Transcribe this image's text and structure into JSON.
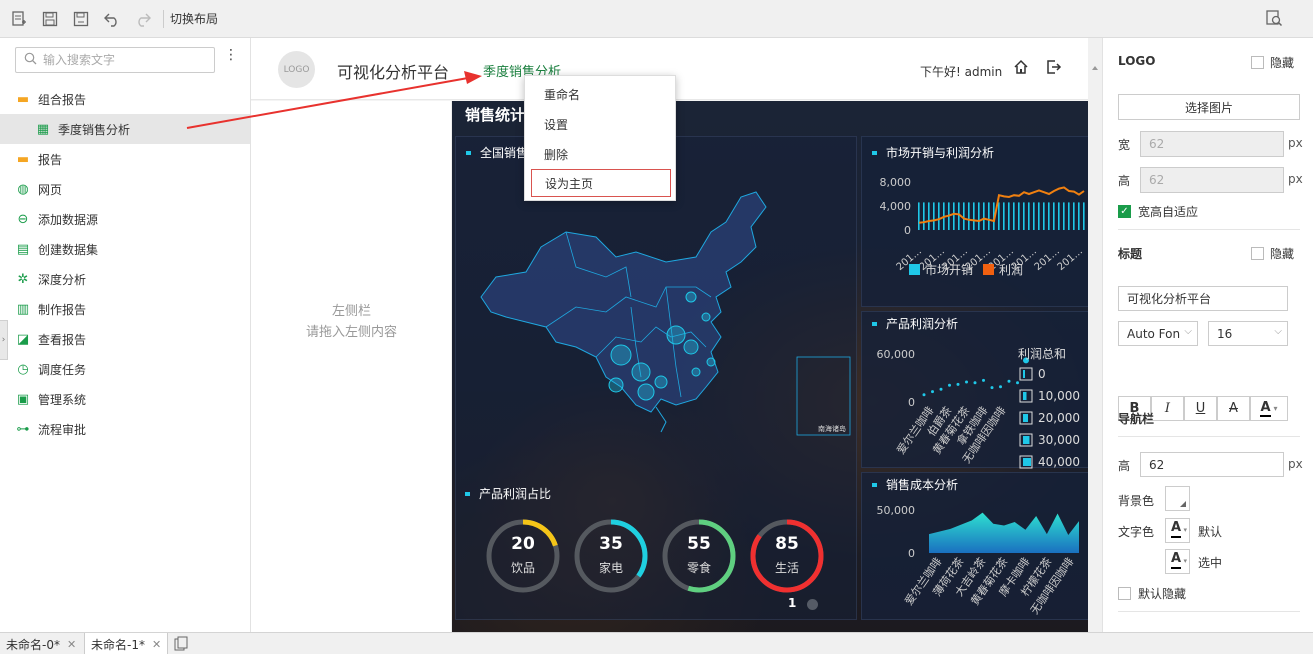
{
  "toolbar": {
    "icons": [
      "new-doc-icon",
      "save-icon",
      "save-as-icon",
      "undo-icon",
      "redo-icon"
    ],
    "switch_layout": "切换布局",
    "right_icon": "preview-icon"
  },
  "sidebar": {
    "search_placeholder": "输入搜索文字",
    "items": [
      {
        "label": "组合报告",
        "icon": "folder-icon",
        "color": "#f5a623"
      },
      {
        "label": "季度销售分析",
        "icon": "layout-icon",
        "color": "#1a9c4a",
        "child": true
      },
      {
        "label": "报告",
        "icon": "folder-icon",
        "color": "#f5a623"
      },
      {
        "label": "网页",
        "icon": "globe-icon",
        "color": "#1a9c4a"
      },
      {
        "label": "添加数据源",
        "icon": "link-icon",
        "color": "#1a9c4a"
      },
      {
        "label": "创建数据集",
        "icon": "dataset-icon",
        "color": "#1a9c4a"
      },
      {
        "label": "深度分析",
        "icon": "analysis-icon",
        "color": "#1a9c4a"
      },
      {
        "label": "制作报告",
        "icon": "chart-icon",
        "color": "#1a9c4a"
      },
      {
        "label": "查看报告",
        "icon": "view-report-icon",
        "color": "#1a9c4a"
      },
      {
        "label": "调度任务",
        "icon": "clock-icon",
        "color": "#1a9c4a"
      },
      {
        "label": "管理系统",
        "icon": "manage-icon",
        "color": "#1a9c4a"
      },
      {
        "label": "流程审批",
        "icon": "flow-icon",
        "color": "#1a9c4a"
      }
    ]
  },
  "header": {
    "logo": "LOGO",
    "title": "可视化分析平台",
    "nav_tab": "季度销售分析",
    "greeting": "下午好! admin"
  },
  "left_pane": {
    "line1": "左侧栏",
    "line2": "请拖入左侧内容"
  },
  "context_menu": {
    "items": [
      "重命名",
      "设置",
      "删除",
      "设为主页"
    ]
  },
  "dashboard": {
    "title": "销售统计",
    "panels": {
      "map": "全国销售",
      "market": "市场开销与利润分析",
      "profit": "产品利润分析",
      "share": "产品利润占比",
      "cost": "销售成本分析"
    },
    "south_sea_label": "南海诸岛",
    "pager": "1"
  },
  "chart_data": [
    {
      "type": "line",
      "title": "市场开销与利润分析",
      "y_ticks": [
        "8,000",
        "4,000",
        "0"
      ],
      "x_tick": "201…",
      "legend": [
        "市场开销",
        "利润"
      ],
      "series": [
        {
          "name": "市场开销",
          "type": "bar",
          "color": "#1fc8e8",
          "values": [
            4600,
            4600,
            4600,
            4600,
            4600,
            4600,
            4600,
            4600,
            4600,
            4600,
            4600,
            4600,
            4600,
            4600,
            4600,
            4600,
            4600,
            4600,
            4600,
            4600,
            4600,
            4600,
            4600,
            4600,
            4600,
            4600,
            4600,
            4600,
            4600,
            4600,
            4600,
            4600,
            4600,
            4600
          ]
        },
        {
          "name": "利润",
          "type": "line",
          "color": "#f08010",
          "values": [
            1200,
            1300,
            1500,
            1600,
            1800,
            2200,
            2400,
            2700,
            2600,
            1900,
            1700,
            1600,
            1500,
            1900,
            1700,
            1500,
            5800,
            5600,
            5500,
            5800,
            5700,
            6300,
            6000,
            6300,
            6600,
            6300,
            6000,
            6500,
            6900,
            7100,
            6500,
            6400,
            5900,
            6500
          ]
        }
      ]
    },
    {
      "type": "scatter",
      "title": "产品利润分析",
      "y_ticks": [
        "60,000",
        "0"
      ],
      "categories": [
        "爱尔兰咖啡",
        "伯爵茶",
        "黄春菊花茶",
        "拿铁咖啡",
        "无咖啡因咖啡"
      ],
      "legend_title": "利润总和",
      "legend": [
        "0",
        "10,000",
        "20,000",
        "30,000",
        "40,000"
      ],
      "points": [
        [
          0,
          9000
        ],
        [
          1,
          13000
        ],
        [
          2,
          16000
        ],
        [
          3,
          21000
        ],
        [
          4,
          22000
        ],
        [
          5,
          25000
        ],
        [
          6,
          24000
        ],
        [
          7,
          27000
        ],
        [
          8,
          18000
        ],
        [
          9,
          19000
        ],
        [
          10,
          26000
        ],
        [
          11,
          24000
        ],
        [
          12,
          52000
        ]
      ]
    },
    {
      "type": "area",
      "title": "销售成本分析",
      "y_ticks": [
        "50,000",
        "0"
      ],
      "categories": [
        "爱尔兰咖啡",
        "薄荷花茶",
        "大吉岭茶",
        "黄春菊花茶",
        "摩卡咖啡",
        "柠檬花茶",
        "无咖啡因咖啡"
      ],
      "color": "#1fc8e8",
      "values": [
        22000,
        25000,
        28000,
        33000,
        38000,
        47000,
        34000,
        32000,
        36000,
        27000,
        43000,
        22000,
        46000,
        21000,
        37000
      ]
    },
    {
      "type": "pie",
      "title": "产品利润占比",
      "slices": [
        {
          "label": "饮品",
          "value": 20,
          "color": "#f5c518"
        },
        {
          "label": "家电",
          "value": 35,
          "color": "#1fd0e0"
        },
        {
          "label": "零食",
          "value": 55,
          "color": "#5fcf80"
        },
        {
          "label": "生活",
          "value": 85,
          "color": "#f03030"
        }
      ]
    }
  ],
  "right_panel": {
    "logo_section": "LOGO",
    "hide": "隐藏",
    "choose_image": "选择图片",
    "width_label": "宽",
    "width_value": "62",
    "height_label": "高",
    "height_value": "62",
    "unit": "px",
    "auto_fit": "宽高自适应",
    "title_section": "标题",
    "title_value": "可视化分析平台",
    "font_family": "Auto Fon",
    "font_size": "16",
    "format_buttons": [
      "B",
      "I",
      "U",
      "A",
      "A"
    ],
    "nav_section": "导航栏",
    "nav_height_label": "高",
    "nav_height_value": "62",
    "bg_color_label": "背景色",
    "text_color_label": "文字色",
    "default_label": "默认",
    "selected_label": "选中",
    "default_hide": "默认隐藏",
    "accent": "#1a9c4a"
  },
  "statusbar": {
    "tabs": [
      "未命名-0*",
      "未命名-1*"
    ]
  }
}
